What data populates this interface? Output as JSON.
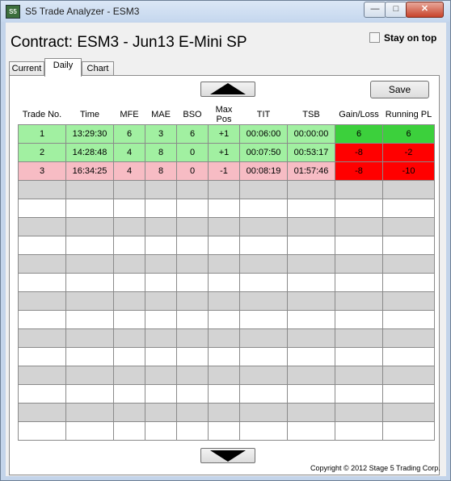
{
  "window": {
    "title": "S5 Trade Analyzer - ESM3",
    "icon_text": "S5",
    "minimize_glyph": "—",
    "maximize_glyph": "□",
    "close_glyph": "✕"
  },
  "header": {
    "contract_title": "Contract: ESM3 - Jun13 E-Mini SP",
    "stay_on_top_label": "Stay on top",
    "stay_on_top_checked": false
  },
  "tabs": [
    {
      "label": "Current",
      "active": false
    },
    {
      "label": "Daily",
      "active": true
    },
    {
      "label": "Chart",
      "active": false
    }
  ],
  "toolbar": {
    "save_label": "Save"
  },
  "table": {
    "columns": [
      "Trade No.",
      "Time",
      "MFE",
      "MAE",
      "BSO",
      "Max Pos",
      "TIT",
      "TSB",
      "Gain/Loss",
      "Running PL"
    ],
    "rows": [
      {
        "trade_no": "1",
        "time": "13:29:30",
        "mfe": "6",
        "mae": "3",
        "bso": "6",
        "max_pos": "+1",
        "tit": "00:06:00",
        "tsb": "00:00:00",
        "gain_loss": "6",
        "running_pl": "6",
        "row_color": "#a1f0a1",
        "gl_color": "#3cd03c",
        "pl_color": "#3cd03c"
      },
      {
        "trade_no": "2",
        "time": "14:28:48",
        "mfe": "4",
        "mae": "8",
        "bso": "0",
        "max_pos": "+1",
        "tit": "00:07:50",
        "tsb": "00:53:17",
        "gain_loss": "-8",
        "running_pl": "-2",
        "row_color": "#a1f0a1",
        "gl_color": "#ff0000",
        "pl_color": "#ff0000"
      },
      {
        "trade_no": "3",
        "time": "16:34:25",
        "mfe": "4",
        "mae": "8",
        "bso": "0",
        "max_pos": "-1",
        "tit": "00:08:19",
        "tsb": "01:57:46",
        "gain_loss": "-8",
        "running_pl": "-10",
        "row_color": "#f7bcc4",
        "gl_color": "#ff0000",
        "pl_color": "#ff0000"
      }
    ]
  },
  "footer": {
    "copyright": "Copyright © 2012 Stage 5 Trading Corp."
  },
  "icons": {
    "scroll_up": "arrow-up-icon",
    "scroll_down": "arrow-down-icon",
    "app": "app-icon"
  }
}
